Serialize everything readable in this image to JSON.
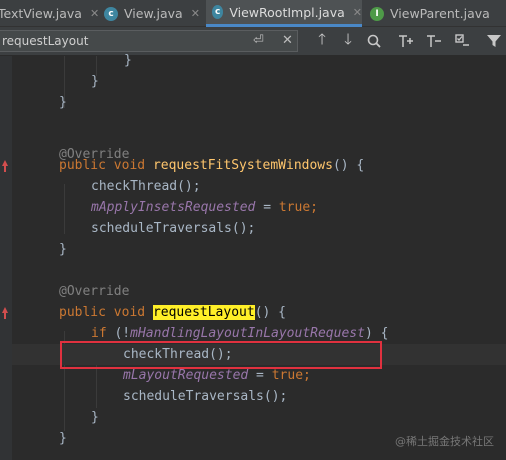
{
  "tabs": [
    {
      "label": "TextView.java",
      "icon": "java-class-icon"
    },
    {
      "label": "View.java",
      "icon": "java-class-icon"
    },
    {
      "label": "ViewRootImpl.java",
      "icon": "java-class-icon"
    },
    {
      "label": "ViewParent.java",
      "icon": "java-interface-icon"
    }
  ],
  "search": {
    "value": "requestLayout"
  },
  "code": {
    "l1": "}",
    "l2": "}",
    "l3": "}",
    "ann1": "@Override",
    "pub1": "public",
    "void1": "void",
    "m1": "requestFitSystemWindows",
    "m1_tail": "() {",
    "call_check1": "checkThread",
    "paren_semi1": "();",
    "fld_insets": "mApplyInsetsRequested",
    "eq1": " = ",
    "true1": "true",
    "semi1": ";",
    "call_sched1": "scheduleTraversals",
    "paren_semi2": "();",
    "close1": "}",
    "ann2": "@Override",
    "pub2": "public",
    "void2": "void",
    "m2": "requestLayout",
    "m2_tail": "() {",
    "if_kw": "if",
    "if_open": " (!",
    "fld_handling": "mHandlingLayoutInLayoutRequest",
    "if_close": ") {",
    "call_check2": "checkThread",
    "paren_semi3": "();",
    "fld_layoutreq": "mLayoutRequested",
    "eq2": " = ",
    "true2": "true",
    "semi2": ";",
    "call_sched2": "scheduleTraversals",
    "paren_semi4": "();",
    "close2": "}",
    "close3": "}"
  },
  "watermark": "@稀土掘金技术社区",
  "colors": {
    "highlight": "#ffef28",
    "annotation_box": "#e0313f"
  }
}
